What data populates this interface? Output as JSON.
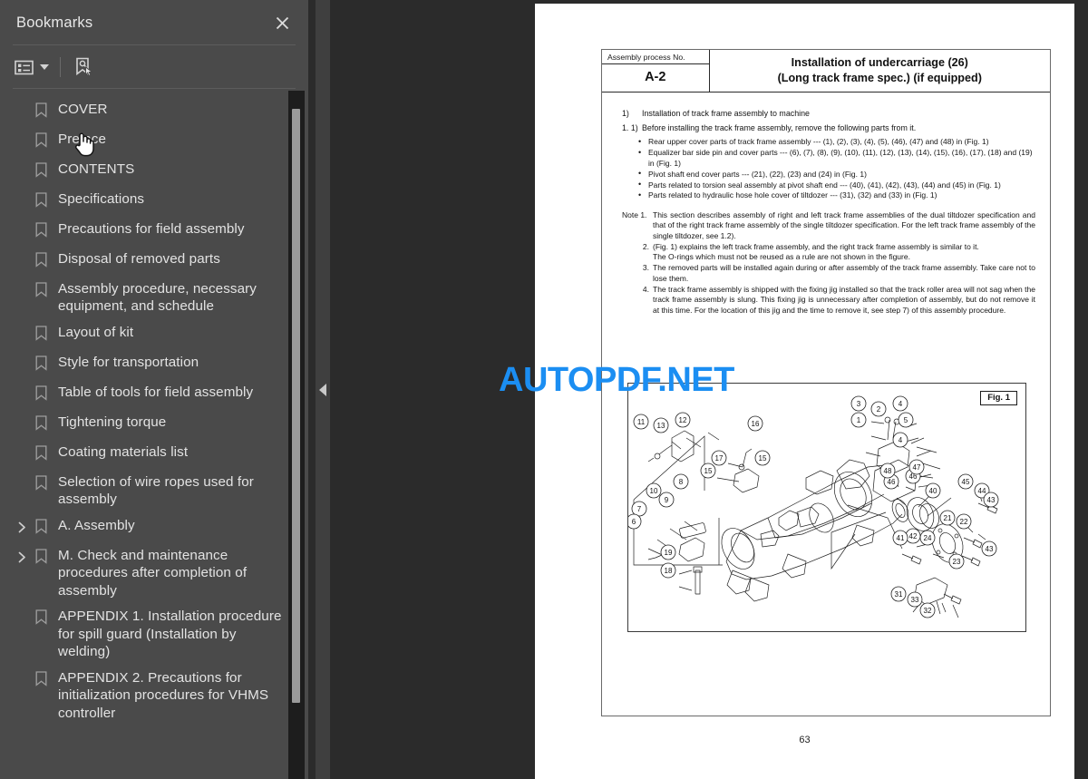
{
  "sidebar": {
    "title": "Bookmarks",
    "close_icon": "close-icon",
    "toolbar": {
      "options_icon": "list-options-icon",
      "options_caret": "chevron-down-icon",
      "find_bookmark_icon": "find-current-bookmark-icon"
    },
    "items": [
      {
        "label": "COVER",
        "expandable": false
      },
      {
        "label": "Preface",
        "expandable": false
      },
      {
        "label": "CONTENTS",
        "expandable": false
      },
      {
        "label": "Specifications",
        "expandable": false
      },
      {
        "label": "Precautions for field assembly",
        "expandable": false
      },
      {
        "label": "Disposal of removed parts",
        "expandable": false
      },
      {
        "label": "Assembly procedure, necessary equipment, and schedule",
        "expandable": false
      },
      {
        "label": "Layout of kit",
        "expandable": false
      },
      {
        "label": "Style for transportation",
        "expandable": false
      },
      {
        "label": "Table of tools for field assembly",
        "expandable": false
      },
      {
        "label": "Tightening torque",
        "expandable": false
      },
      {
        "label": "Coating materials list",
        "expandable": false
      },
      {
        "label": "Selection of wire ropes used for assembly",
        "expandable": false
      },
      {
        "label": "A. Assembly",
        "expandable": true
      },
      {
        "label": "M.  Check and maintenance procedures after completion of assembly",
        "expandable": true
      },
      {
        "label": "APPENDIX 1. Installation procedure for spill guard (Installation by welding)",
        "expandable": false
      },
      {
        "label": "APPENDIX 2. Precautions for initialization procedures for VHMS controller",
        "expandable": false
      }
    ]
  },
  "viewer": {
    "collapse_handle_icon": "collapse-left-triangle-icon",
    "watermark": "AUTOPDF.NET",
    "watermark_color": "#1b8ef2"
  },
  "document": {
    "header": {
      "process_label": "Assembly process No.",
      "process_no": "A-2",
      "title_line1": "Installation of undercarriage (26)",
      "title_line2": "(Long track frame spec.) (if equipped)"
    },
    "section": {
      "number": "1)",
      "heading": "Installation of track frame assembly to machine"
    },
    "step": {
      "number": "1. 1)",
      "lead": "Before installing the track frame assembly, remove the following parts from it.",
      "bullets": [
        "Rear upper cover parts of track frame assembly --- (1), (2), (3), (4), (5), (46), (47) and (48) in (Fig. 1)",
        "Equalizer bar side pin and cover parts --- (6), (7), (8), (9), (10), (11), (12), (13), (14), (15), (16), (17), (18) and (19) in (Fig. 1)",
        "Pivot shaft end cover parts --- (21), (22), (23) and (24) in (Fig. 1)",
        "Parts related to torsion seal assembly at pivot shaft end --- (40), (41), (42), (43), (44) and (45) in (Fig. 1)",
        "Parts related to hydraulic hose hole cover of tiltdozer --- (31), (32) and (33) in (Fig. 1)"
      ]
    },
    "notes": {
      "label": "Note",
      "items": [
        {
          "num": "1.",
          "text": "This section describes assembly of right and left track frame assemblies of the dual tiltdozer specification and that of the right track frame assembly of the single tiltdozer specification. For the left track frame assembly of the single tiltdozer, see 1.2)."
        },
        {
          "num": "2.",
          "text": "(Fig. 1) explains the left track frame assembly, and the right track frame assembly is similar to it."
        },
        {
          "num": "",
          "text": "The O-rings which must not be reused as a rule are not shown in the figure."
        },
        {
          "num": "3.",
          "text": "The removed parts will be installed again during or after assembly of the track frame assembly.  Take care not to lose them."
        },
        {
          "num": "4.",
          "text": "The track frame assembly is shipped with the fixing jig installed so that the track roller area will not sag when the track frame assembly is slung.  This fixing jig is unnecessary after completion of assembly, but do not remove it at this time.  For the location of this jig and the time to remove it, see step 7) of this assembly procedure."
        }
      ]
    },
    "figure": {
      "tag": "Fig. 1",
      "callouts": [
        "1",
        "2",
        "3",
        "4",
        "5",
        "6",
        "7",
        "8",
        "9",
        "10",
        "11",
        "12",
        "13",
        "15",
        "16",
        "17",
        "18",
        "19",
        "21",
        "22",
        "23",
        "24",
        "24",
        "31",
        "32",
        "33",
        "40",
        "41",
        "42",
        "43",
        "44",
        "45",
        "46",
        "46",
        "47",
        "48"
      ]
    },
    "page_number": "63"
  }
}
